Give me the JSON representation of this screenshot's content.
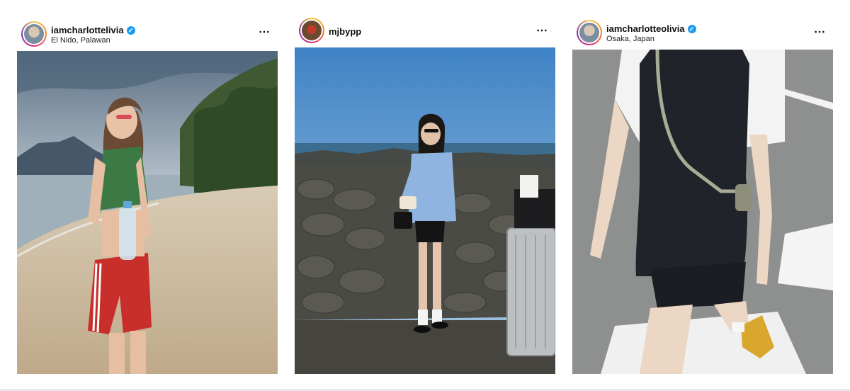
{
  "posts": [
    {
      "username": "iamcharlottelivia",
      "verified": true,
      "location": "El Nido, Palawan",
      "more_icon": "⋯",
      "photo_icon": "beach-photo"
    },
    {
      "username": "mjbypp",
      "verified": false,
      "location": "",
      "more_icon": "⋯",
      "photo_icon": "seaside-rocks-photo"
    },
    {
      "username": "iamcharlotteolivia",
      "verified": true,
      "location": "Osaka, Japan",
      "more_icon": "⋯",
      "photo_icon": "street-crosswalk-photo"
    }
  ],
  "colors": {
    "verified_badge": "#1d9bf0",
    "story_ring": [
      "#f7c948",
      "#f58529",
      "#dd2a7b",
      "#8134af"
    ]
  }
}
